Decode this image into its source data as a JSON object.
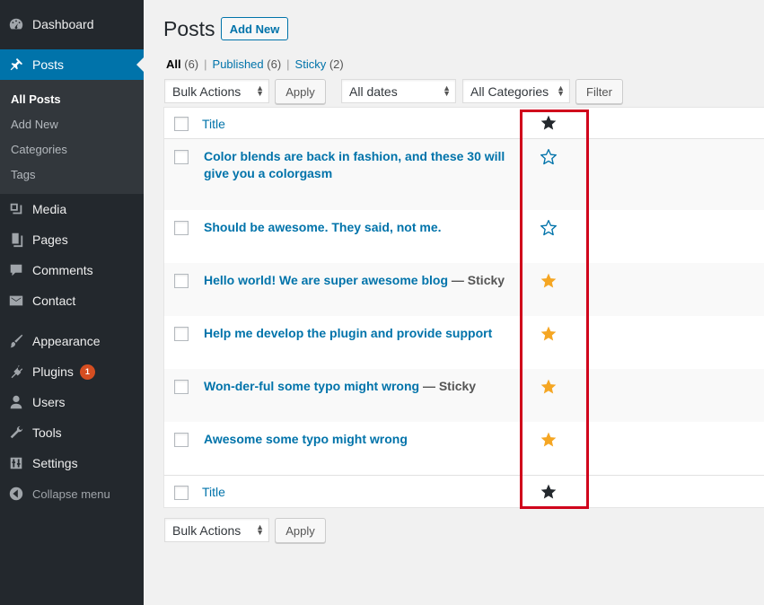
{
  "sidebar": {
    "dashboard": "Dashboard",
    "posts": "Posts",
    "submenu": [
      "All Posts",
      "Add New",
      "Categories",
      "Tags"
    ],
    "media": "Media",
    "pages": "Pages",
    "comments": "Comments",
    "contact": "Contact",
    "appearance": "Appearance",
    "plugins": "Plugins",
    "plugins_badge": "1",
    "users": "Users",
    "tools": "Tools",
    "settings": "Settings",
    "collapse": "Collapse menu"
  },
  "header": {
    "title": "Posts",
    "add_new": "Add New"
  },
  "views": {
    "all": "All",
    "all_count": "(6)",
    "published": "Published",
    "published_count": "(6)",
    "sticky": "Sticky",
    "sticky_count": "(2)",
    "sep": "|"
  },
  "filters": {
    "bulk_actions": "Bulk Actions",
    "apply": "Apply",
    "dates": "All dates",
    "categories": "All Categories",
    "filter": "Filter"
  },
  "table": {
    "column_title": "Title",
    "rows": [
      {
        "title": "Color blends are back in fashion, and these 30 will give you a colorgasm",
        "state": "",
        "sticky": false
      },
      {
        "title": "Should be awesome. They said, not me.",
        "state": "",
        "sticky": false
      },
      {
        "title": "Hello world! We are super awesome blog",
        "state": "— Sticky",
        "sticky": true
      },
      {
        "title": "Help me develop the plugin and provide support",
        "state": "",
        "sticky": true
      },
      {
        "title": "Won-der-ful some typo might wrong",
        "state": "— Sticky",
        "sticky": true
      },
      {
        "title": "Awesome some typo might wrong",
        "state": "",
        "sticky": true
      }
    ]
  },
  "bottom": {
    "bulk_actions": "Bulk Actions",
    "apply": "Apply"
  },
  "colors": {
    "sidebar_bg": "#23282d",
    "accent": "#0073aa",
    "star_active": "#f5a623",
    "star_inactive": "#0073aa",
    "highlight": "#d0021b"
  }
}
